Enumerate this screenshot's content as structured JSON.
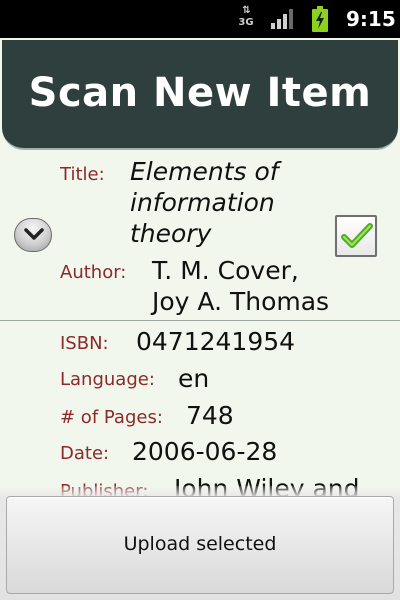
{
  "status_bar": {
    "network_type": "3G",
    "network_arrows": "⇅",
    "time": "9:15",
    "icons": [
      "signal-icon",
      "battery-charging-icon"
    ]
  },
  "header": {
    "title": "Scan New Item"
  },
  "item": {
    "title_label": "Title:",
    "title_lines": [
      "Elements of",
      "information",
      "theory"
    ],
    "author_label": "Author:",
    "author_lines": [
      "T. M. Cover,",
      "Joy A. Thomas"
    ],
    "selected": true,
    "expand_icon": "chevron-down-icon",
    "check_icon": "check-icon"
  },
  "details": {
    "isbn_label": "ISBN:",
    "isbn": "0471241954",
    "language_label": "Language:",
    "language": "en",
    "pages_label": "# of Pages:",
    "pages": "748",
    "date_label": "Date:",
    "date": "2006-06-28",
    "publisher_label": "Publisher:",
    "publisher": "John Wiley and"
  },
  "footer": {
    "upload_label": "Upload selected"
  },
  "colors": {
    "header_bg": "#2e3f3d",
    "label_color": "#8a2a2a",
    "check_green": "#4caf1e",
    "page_bg": "#f2f7ee"
  }
}
